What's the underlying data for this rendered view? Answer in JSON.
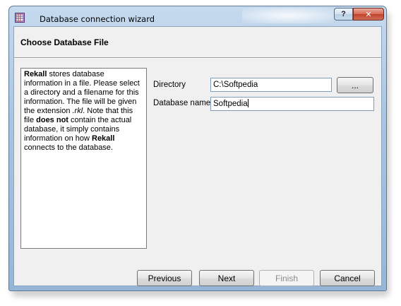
{
  "window": {
    "title": "Database connection wizard",
    "help_label": "?",
    "close_label": "✕",
    "app_icon": "database-grid-icon"
  },
  "page": {
    "heading": "Choose Database File"
  },
  "info": {
    "p1_bold": "Rekall",
    "p1_rest": " stores database information in a file. Please select a directory and a filename for this information. The file will be given the extension ",
    "extension": ".rkl",
    "p2": ". Note that this file ",
    "does_not": "does not",
    "p3": " contain the actual database, it simply contains information on how ",
    "p4_bold": "Rekall",
    "p4_rest": " connects to the database."
  },
  "form": {
    "directory_label": "Directory",
    "directory_value": "C:\\Softpedia",
    "browse_label": "...",
    "dbname_label": "Database name",
    "dbname_value": "Softpedia"
  },
  "buttons": {
    "previous": "Previous",
    "next": "Next",
    "finish": "Finish",
    "cancel": "Cancel"
  }
}
